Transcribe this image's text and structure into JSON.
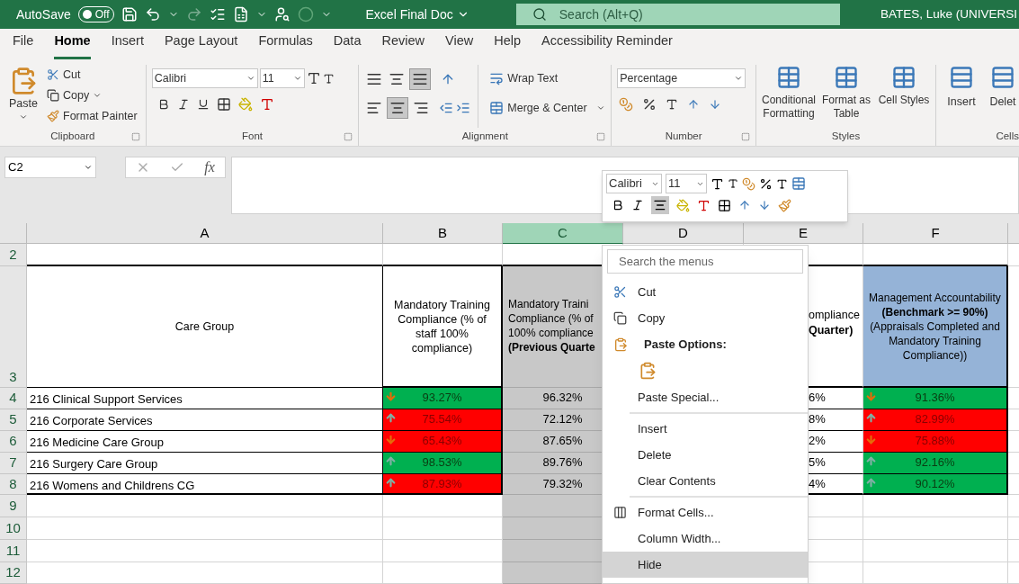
{
  "title_bar": {
    "autosave_label": "AutoSave",
    "autosave": {
      "on": false,
      "label": "Off"
    },
    "redo": {
      "disabled": true
    },
    "document_title": "Excel Final Doc",
    "search": {
      "placeholder": "Search (Alt+Q)"
    },
    "user": "BATES, Luke (UNIVERSI"
  },
  "ribbon_tabs": [
    {
      "label": "File",
      "selected": false
    },
    {
      "label": "Home",
      "selected": true
    },
    {
      "label": "Insert",
      "selected": false
    },
    {
      "label": "Page Layout",
      "selected": false
    },
    {
      "label": "Formulas",
      "selected": false
    },
    {
      "label": "Data",
      "selected": false
    },
    {
      "label": "Review",
      "selected": false
    },
    {
      "label": "View",
      "selected": false
    },
    {
      "label": "Help",
      "selected": false
    },
    {
      "label": "Accessibility Reminder",
      "selected": false
    }
  ],
  "clipboard": {
    "paste": "Paste",
    "cut": "Cut",
    "copy": "Copy",
    "format_painter": "Format Painter",
    "label": "Clipboard"
  },
  "font": {
    "name": "Calibri",
    "size": "11",
    "label": "Font"
  },
  "alignment": {
    "vertical": [
      {
        "kind": "top",
        "selected": false
      },
      {
        "kind": "middle",
        "selected": false
      },
      {
        "kind": "bottom",
        "selected": true
      }
    ],
    "horizontal": [
      {
        "kind": "left",
        "selected": false
      },
      {
        "kind": "center",
        "selected": true
      },
      {
        "kind": "right",
        "selected": false
      }
    ],
    "wrap_text": "Wrap Text",
    "merge": "Merge & Center",
    "label": "Alignment"
  },
  "number": {
    "format": "Percentage",
    "label": "Number"
  },
  "styles": {
    "buttons": [
      "Conditional Formatting",
      "Format as Table",
      "Cell Styles"
    ],
    "label": "Styles"
  },
  "cells": {
    "buttons": [
      "Insert",
      "Delet"
    ],
    "label": "Cells"
  },
  "formula_bar": {
    "name_box": "C2",
    "function_label": "fx"
  },
  "columns": [
    {
      "letter": "A",
      "selected": false
    },
    {
      "letter": "B",
      "selected": false
    },
    {
      "letter": "C",
      "selected": true
    },
    {
      "letter": "D",
      "selected": false
    },
    {
      "letter": "E",
      "selected": false
    },
    {
      "letter": "F",
      "selected": false
    }
  ],
  "row_numbers": [
    "2",
    "3",
    "4",
    "5",
    "6",
    "7",
    "8",
    "9",
    "10",
    "11",
    "12"
  ],
  "table_header": {
    "care_group": "Care Group",
    "b": "Mandatory Training Compliance (% of staff 100% compliance)",
    "c_lines": [
      "Mandatory Traini",
      "Compliance (% of",
      "100% compliance",
      "**(Previous Quarte**"
    ],
    "e_lines": [
      "ompliance",
      "**Quarter)**"
    ],
    "f": "Management Accountability **(Benchmark >= 90%)** (Appraisals Completed and Mandatory Training Compliance))"
  },
  "table_rows": [
    {
      "care_group": "216 Clinical Support Services",
      "b": {
        "value": "93.27%",
        "rising": false,
        "on_target": true
      },
      "c": "96.32%",
      "e": "6%",
      "f": {
        "value": "91.36%",
        "rising": false,
        "on_target": true
      }
    },
    {
      "care_group": "216 Corporate Services",
      "b": {
        "value": "75.54%",
        "rising": true,
        "on_target": false
      },
      "c": "72.12%",
      "e": "8%",
      "f": {
        "value": "82.99%",
        "rising": true,
        "on_target": false
      }
    },
    {
      "care_group": "216 Medicine Care Group",
      "b": {
        "value": "65.43%",
        "rising": false,
        "on_target": false
      },
      "c": "87.65%",
      "e": "2%",
      "f": {
        "value": "75.88%",
        "rising": false,
        "on_target": false
      }
    },
    {
      "care_group": "216 Surgery Care Group",
      "b": {
        "value": "98.53%",
        "rising": true,
        "on_target": true
      },
      "c": "89.76%",
      "e": "5%",
      "f": {
        "value": "92.16%",
        "rising": true,
        "on_target": true
      }
    },
    {
      "care_group": "216 Womens and Childrens CG",
      "b": {
        "value": "87.93%",
        "rising": true,
        "on_target": false
      },
      "c": "79.32%",
      "e": "4%",
      "f": {
        "value": "90.12%",
        "rising": true,
        "on_target": true
      }
    }
  ],
  "mini_toolbar": {
    "font": "Calibri",
    "size": "11",
    "center_selected": true
  },
  "context_menu": {
    "search": {
      "placeholder": "Search the menus"
    },
    "items": [
      {
        "kind": "cut",
        "label": "Cut",
        "selected": false
      },
      {
        "kind": "copy",
        "label": "Copy",
        "selected": false
      },
      {
        "kind": "heading",
        "label": "Paste Options:"
      },
      {
        "kind": "paste"
      },
      {
        "kind": "command",
        "label": "Paste Special...",
        "selected": false
      },
      {
        "kind": "divider"
      },
      {
        "kind": "command",
        "label": "Insert",
        "selected": false
      },
      {
        "kind": "command",
        "label": "Delete",
        "selected": false
      },
      {
        "kind": "command",
        "label": "Clear Contents",
        "selected": false
      },
      {
        "kind": "divider"
      },
      {
        "kind": "format",
        "label": "Format Cells...",
        "selected": false
      },
      {
        "kind": "command",
        "label": "Column Width...",
        "selected": false
      },
      {
        "kind": "command",
        "label": "Hide",
        "selected": true
      }
    ]
  }
}
